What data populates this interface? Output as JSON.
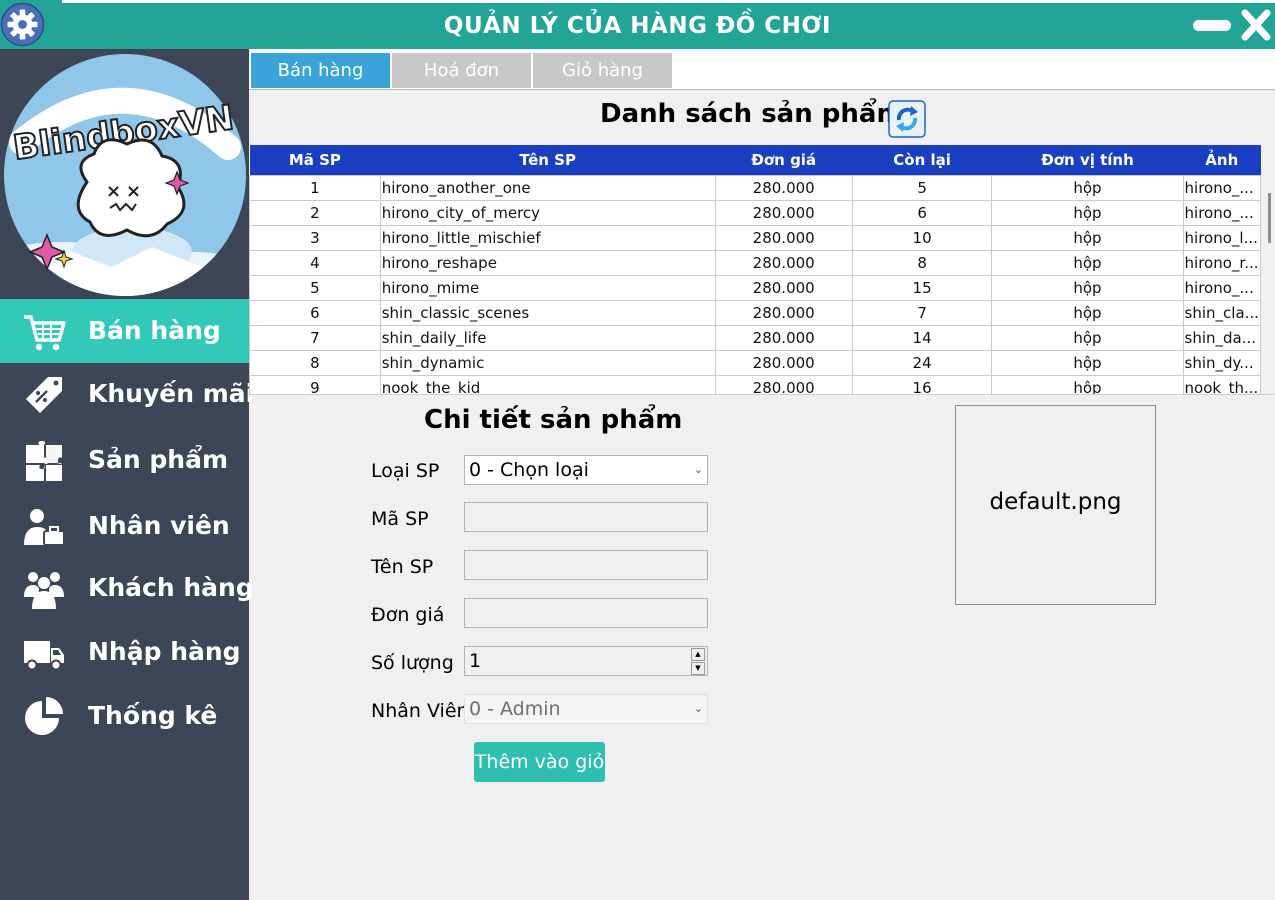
{
  "window": {
    "title": "QUẢN LÝ CỦA HÀNG ĐỒ CHƠI",
    "accent_color": "#22a496",
    "icons": {
      "settings": "gear-icon",
      "minimize": "minimize-icon",
      "close": "close-icon"
    }
  },
  "logo": {
    "text": "BlindboxVN"
  },
  "sidebar": {
    "items": [
      {
        "label": "Bán hàng",
        "icon": "shopping-cart-icon",
        "active": true
      },
      {
        "label": "Khuyến mãi",
        "icon": "discount-tag-icon"
      },
      {
        "label": "Sản phẩm",
        "icon": "puzzle-icon"
      },
      {
        "label": "Nhân viên",
        "icon": "employee-icon"
      },
      {
        "label": "Khách hàng",
        "icon": "customers-icon"
      },
      {
        "label": "Nhập hàng",
        "icon": "truck-icon"
      },
      {
        "label": "Thống kê",
        "icon": "pie-chart-icon"
      }
    ]
  },
  "tabs": [
    {
      "label": "Bán hàng",
      "active": true
    },
    {
      "label": "Hoá đơn"
    },
    {
      "label": "Giỏ hàng"
    }
  ],
  "product_list": {
    "title": "Danh sách sản phẩm",
    "columns": [
      "Mã SP",
      "Tên SP",
      "Đơn giá",
      "Còn lại",
      "Đơn vị tính",
      "Ảnh"
    ],
    "rows": [
      [
        "1",
        "hirono_another_one",
        "280.000",
        "5",
        "hộp",
        "hirono_..."
      ],
      [
        "2",
        "hirono_city_of_mercy",
        "280.000",
        "6",
        "hộp",
        "hirono_..."
      ],
      [
        "3",
        "hirono_little_mischief",
        "280.000",
        "10",
        "hộp",
        "hirono_l..."
      ],
      [
        "4",
        "hirono_reshape",
        "280.000",
        "8",
        "hộp",
        "hirono_r..."
      ],
      [
        "5",
        "hirono_mime",
        "280.000",
        "15",
        "hộp",
        "hirono_..."
      ],
      [
        "6",
        "shin_classic_scenes",
        "280.000",
        "7",
        "hộp",
        "shin_cla..."
      ],
      [
        "7",
        "shin_daily_life",
        "280.000",
        "14",
        "hộp",
        "shin_da..."
      ],
      [
        "8",
        "shin_dynamic",
        "280.000",
        "24",
        "hộp",
        "shin_dy..."
      ],
      [
        "9",
        "nook_the_kid",
        "280.000",
        "16",
        "hộp",
        "nook_th..."
      ]
    ]
  },
  "detail": {
    "title": "Chi tiết sản phẩm",
    "labels": {
      "category": "Loại SP",
      "code": "Mã SP",
      "name": "Tên SP",
      "price": "Đơn giá",
      "quantity": "Số lượng",
      "employee": "Nhân Viên"
    },
    "values": {
      "category": "0 - Chọn loại",
      "code": "",
      "name": "",
      "price": "",
      "quantity": "1",
      "employee": "0 - Admin"
    },
    "add_button": "Thêm vào giỏ",
    "image_name": "default.png"
  }
}
